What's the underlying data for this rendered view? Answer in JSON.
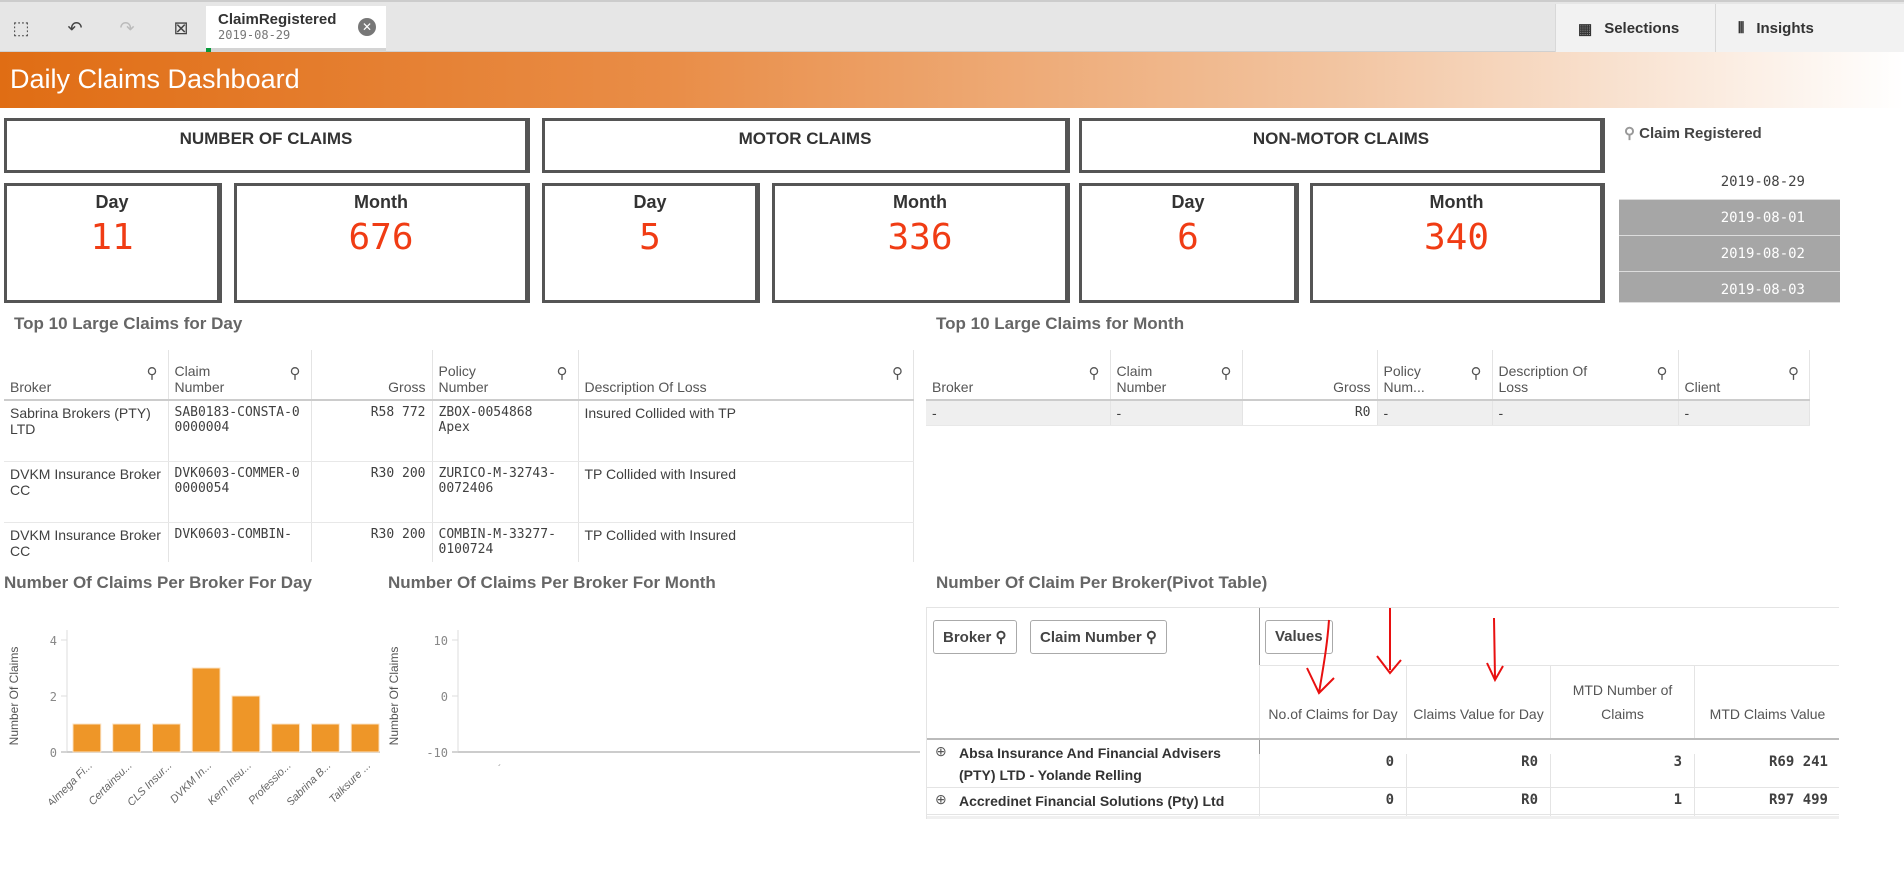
{
  "toolbar": {
    "selection_field": "ClaimRegistered",
    "selection_value": "2019-08-29",
    "selections_label": "Selections",
    "insights_label": "Insights"
  },
  "header": {
    "title": "Daily Claims Dashboard"
  },
  "kpis": [
    {
      "title": "NUMBER OF CLAIMS",
      "day_label": "Day",
      "day_value": "11",
      "month_label": "Month",
      "month_value": "676"
    },
    {
      "title": "MOTOR CLAIMS",
      "day_label": "Day",
      "day_value": "5",
      "month_label": "Month",
      "month_value": "336"
    },
    {
      "title": "NON-MOTOR CLAIMS",
      "day_label": "Day",
      "day_value": "6",
      "month_label": "Month",
      "month_value": "340"
    }
  ],
  "filter": {
    "title": "Claim Registered",
    "selected": "2019-08-29",
    "options": [
      "2019-08-01",
      "2019-08-02",
      "2019-08-03"
    ]
  },
  "day_table": {
    "title": "Top 10 Large Claims for Day",
    "headers": [
      "Broker",
      "Claim Number",
      "Gross",
      "Policy Number",
      "Description Of Loss"
    ],
    "rows": [
      [
        "Sabrina Brokers (PTY) LTD",
        "SAB0183-CONSTA-00000004",
        "R58 772",
        "ZBOX-0054868 Apex",
        "Insured Collided with TP"
      ],
      [
        "DVKM Insurance Broker CC",
        "DVK0603-COMMER-00000054",
        "R30 200",
        "ZURICO-M-32743-0072406",
        "TP Collided with Insured"
      ],
      [
        "DVKM Insurance Broker CC",
        "DVK0603-COMBIN-",
        "R30 200",
        "COMBIN-M-33277-0100724",
        "TP Collided with Insured"
      ]
    ]
  },
  "month_table": {
    "title": "Top 10 Large Claims for Month",
    "headers": [
      "Broker",
      "Claim Number",
      "Gross",
      "Policy Num...",
      "Description Of Loss",
      "Client"
    ],
    "rows": [
      [
        "-",
        "-",
        "R0",
        "-",
        "-",
        "-"
      ]
    ]
  },
  "chart_data": [
    {
      "type": "bar",
      "title": "Number Of Claims Per Broker For Day",
      "xlabel": "",
      "ylabel": "Number Of Claims",
      "ylim": [
        0,
        4
      ],
      "yticks": [
        "0",
        "2",
        "4"
      ],
      "categories": [
        "Almega Fi...",
        "Certainsu...",
        "CLS Insur...",
        "DVKM In...",
        "Kern Insu...",
        "Professio...",
        "Sabrina B...",
        "Talksure ..."
      ],
      "values": [
        1,
        1,
        1,
        3,
        2,
        1,
        1,
        1
      ],
      "color": "#ee9628"
    },
    {
      "type": "bar",
      "title": "Number Of Claims Per Broker For Month",
      "xlabel": "",
      "ylabel": "Number Of Claims",
      "ylim": [
        -10,
        10
      ],
      "yticks": [
        "-10",
        "0",
        "10"
      ],
      "categories": [],
      "values": []
    }
  ],
  "pivot": {
    "title": "Number Of Claim Per Broker(Pivot Table)",
    "dims": [
      "Broker",
      "Claim Number"
    ],
    "values_label": "Values",
    "headers": [
      "No.of Claims for Day",
      "Claims Value for Day",
      "MTD Number of Claims",
      "MTD Claims Value"
    ],
    "rows": [
      {
        "broker": "Absa Insurance And Financial Advisers (PTY) LTD - Yolande Relling",
        "vals": [
          "0",
          "R0",
          "3",
          "R69 241"
        ]
      },
      {
        "broker": "Accredinet Financial Solutions (Pty) Ltd",
        "vals": [
          "0",
          "R0",
          "1",
          "R97 499"
        ]
      }
    ]
  }
}
